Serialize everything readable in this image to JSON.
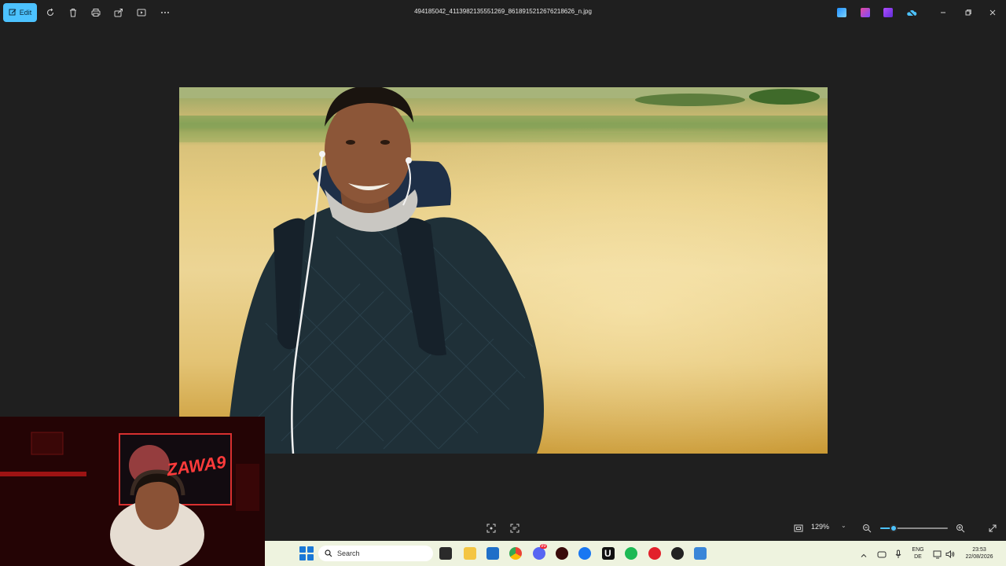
{
  "toolbar": {
    "edit_label": "Edit",
    "file_name": "494185042_4113982135551269_8618915212676218626_n.jpg"
  },
  "viewer": {
    "zoom": "129%",
    "zoom_level": 0.2
  },
  "webcam": {
    "sign_text": "ZAWA9"
  },
  "taskbar": {
    "search_placeholder": "Search",
    "language_top": "ENG",
    "language_bottom": "DE",
    "time": "23:53",
    "date": "22/08/2026",
    "discord_badge": "99"
  },
  "colors": {
    "accent": "#4cc2ff",
    "background": "#1f1f1f",
    "taskbar": "#eef3df"
  }
}
